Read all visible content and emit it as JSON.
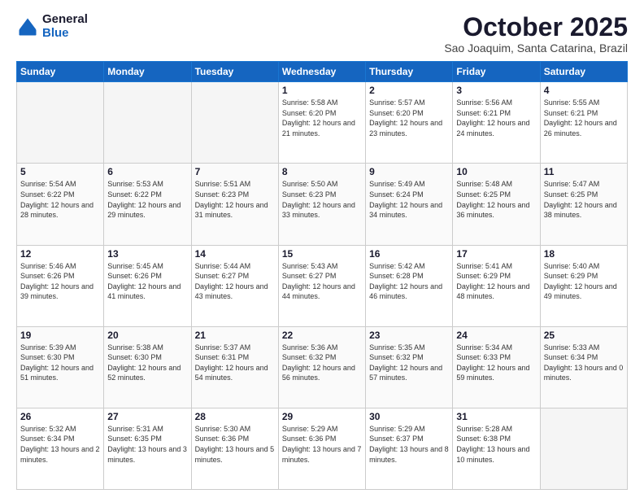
{
  "header": {
    "logo_line1": "General",
    "logo_line2": "Blue",
    "month": "October 2025",
    "location": "Sao Joaquim, Santa Catarina, Brazil"
  },
  "weekdays": [
    "Sunday",
    "Monday",
    "Tuesday",
    "Wednesday",
    "Thursday",
    "Friday",
    "Saturday"
  ],
  "weeks": [
    [
      {
        "day": "",
        "info": ""
      },
      {
        "day": "",
        "info": ""
      },
      {
        "day": "",
        "info": ""
      },
      {
        "day": "1",
        "info": "Sunrise: 5:58 AM\nSunset: 6:20 PM\nDaylight: 12 hours\nand 21 minutes."
      },
      {
        "day": "2",
        "info": "Sunrise: 5:57 AM\nSunset: 6:20 PM\nDaylight: 12 hours\nand 23 minutes."
      },
      {
        "day": "3",
        "info": "Sunrise: 5:56 AM\nSunset: 6:21 PM\nDaylight: 12 hours\nand 24 minutes."
      },
      {
        "day": "4",
        "info": "Sunrise: 5:55 AM\nSunset: 6:21 PM\nDaylight: 12 hours\nand 26 minutes."
      }
    ],
    [
      {
        "day": "5",
        "info": "Sunrise: 5:54 AM\nSunset: 6:22 PM\nDaylight: 12 hours\nand 28 minutes."
      },
      {
        "day": "6",
        "info": "Sunrise: 5:53 AM\nSunset: 6:22 PM\nDaylight: 12 hours\nand 29 minutes."
      },
      {
        "day": "7",
        "info": "Sunrise: 5:51 AM\nSunset: 6:23 PM\nDaylight: 12 hours\nand 31 minutes."
      },
      {
        "day": "8",
        "info": "Sunrise: 5:50 AM\nSunset: 6:23 PM\nDaylight: 12 hours\nand 33 minutes."
      },
      {
        "day": "9",
        "info": "Sunrise: 5:49 AM\nSunset: 6:24 PM\nDaylight: 12 hours\nand 34 minutes."
      },
      {
        "day": "10",
        "info": "Sunrise: 5:48 AM\nSunset: 6:25 PM\nDaylight: 12 hours\nand 36 minutes."
      },
      {
        "day": "11",
        "info": "Sunrise: 5:47 AM\nSunset: 6:25 PM\nDaylight: 12 hours\nand 38 minutes."
      }
    ],
    [
      {
        "day": "12",
        "info": "Sunrise: 5:46 AM\nSunset: 6:26 PM\nDaylight: 12 hours\nand 39 minutes."
      },
      {
        "day": "13",
        "info": "Sunrise: 5:45 AM\nSunset: 6:26 PM\nDaylight: 12 hours\nand 41 minutes."
      },
      {
        "day": "14",
        "info": "Sunrise: 5:44 AM\nSunset: 6:27 PM\nDaylight: 12 hours\nand 43 minutes."
      },
      {
        "day": "15",
        "info": "Sunrise: 5:43 AM\nSunset: 6:27 PM\nDaylight: 12 hours\nand 44 minutes."
      },
      {
        "day": "16",
        "info": "Sunrise: 5:42 AM\nSunset: 6:28 PM\nDaylight: 12 hours\nand 46 minutes."
      },
      {
        "day": "17",
        "info": "Sunrise: 5:41 AM\nSunset: 6:29 PM\nDaylight: 12 hours\nand 48 minutes."
      },
      {
        "day": "18",
        "info": "Sunrise: 5:40 AM\nSunset: 6:29 PM\nDaylight: 12 hours\nand 49 minutes."
      }
    ],
    [
      {
        "day": "19",
        "info": "Sunrise: 5:39 AM\nSunset: 6:30 PM\nDaylight: 12 hours\nand 51 minutes."
      },
      {
        "day": "20",
        "info": "Sunrise: 5:38 AM\nSunset: 6:30 PM\nDaylight: 12 hours\nand 52 minutes."
      },
      {
        "day": "21",
        "info": "Sunrise: 5:37 AM\nSunset: 6:31 PM\nDaylight: 12 hours\nand 54 minutes."
      },
      {
        "day": "22",
        "info": "Sunrise: 5:36 AM\nSunset: 6:32 PM\nDaylight: 12 hours\nand 56 minutes."
      },
      {
        "day": "23",
        "info": "Sunrise: 5:35 AM\nSunset: 6:32 PM\nDaylight: 12 hours\nand 57 minutes."
      },
      {
        "day": "24",
        "info": "Sunrise: 5:34 AM\nSunset: 6:33 PM\nDaylight: 12 hours\nand 59 minutes."
      },
      {
        "day": "25",
        "info": "Sunrise: 5:33 AM\nSunset: 6:34 PM\nDaylight: 13 hours\nand 0 minutes."
      }
    ],
    [
      {
        "day": "26",
        "info": "Sunrise: 5:32 AM\nSunset: 6:34 PM\nDaylight: 13 hours\nand 2 minutes."
      },
      {
        "day": "27",
        "info": "Sunrise: 5:31 AM\nSunset: 6:35 PM\nDaylight: 13 hours\nand 3 minutes."
      },
      {
        "day": "28",
        "info": "Sunrise: 5:30 AM\nSunset: 6:36 PM\nDaylight: 13 hours\nand 5 minutes."
      },
      {
        "day": "29",
        "info": "Sunrise: 5:29 AM\nSunset: 6:36 PM\nDaylight: 13 hours\nand 7 minutes."
      },
      {
        "day": "30",
        "info": "Sunrise: 5:29 AM\nSunset: 6:37 PM\nDaylight: 13 hours\nand 8 minutes."
      },
      {
        "day": "31",
        "info": "Sunrise: 5:28 AM\nSunset: 6:38 PM\nDaylight: 13 hours\nand 10 minutes."
      },
      {
        "day": "",
        "info": ""
      }
    ]
  ]
}
